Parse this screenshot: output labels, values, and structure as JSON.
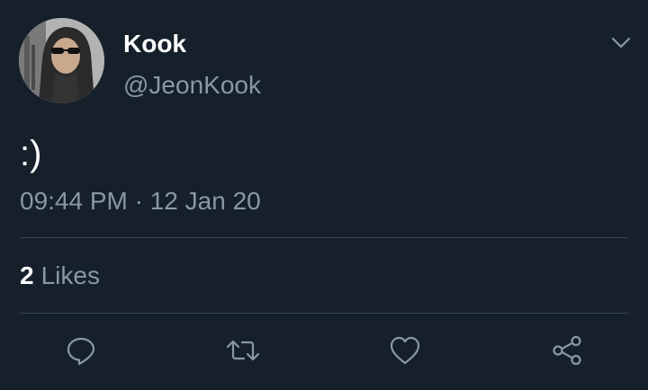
{
  "tweet": {
    "author": {
      "display_name": "Kook",
      "handle": "@JeonKook"
    },
    "text": ":)",
    "timestamp": "09:44 PM · 12 Jan 20",
    "likes": {
      "count": "2",
      "label": "Likes"
    }
  },
  "icons": {
    "menu": "chevron-down-icon",
    "reply": "reply-icon",
    "retweet": "retweet-icon",
    "like": "heart-icon",
    "share": "share-icon"
  },
  "colors": {
    "background": "#15202b",
    "primary_text": "#ffffff",
    "secondary_text": "#8899a6",
    "divider": "#38444d"
  }
}
